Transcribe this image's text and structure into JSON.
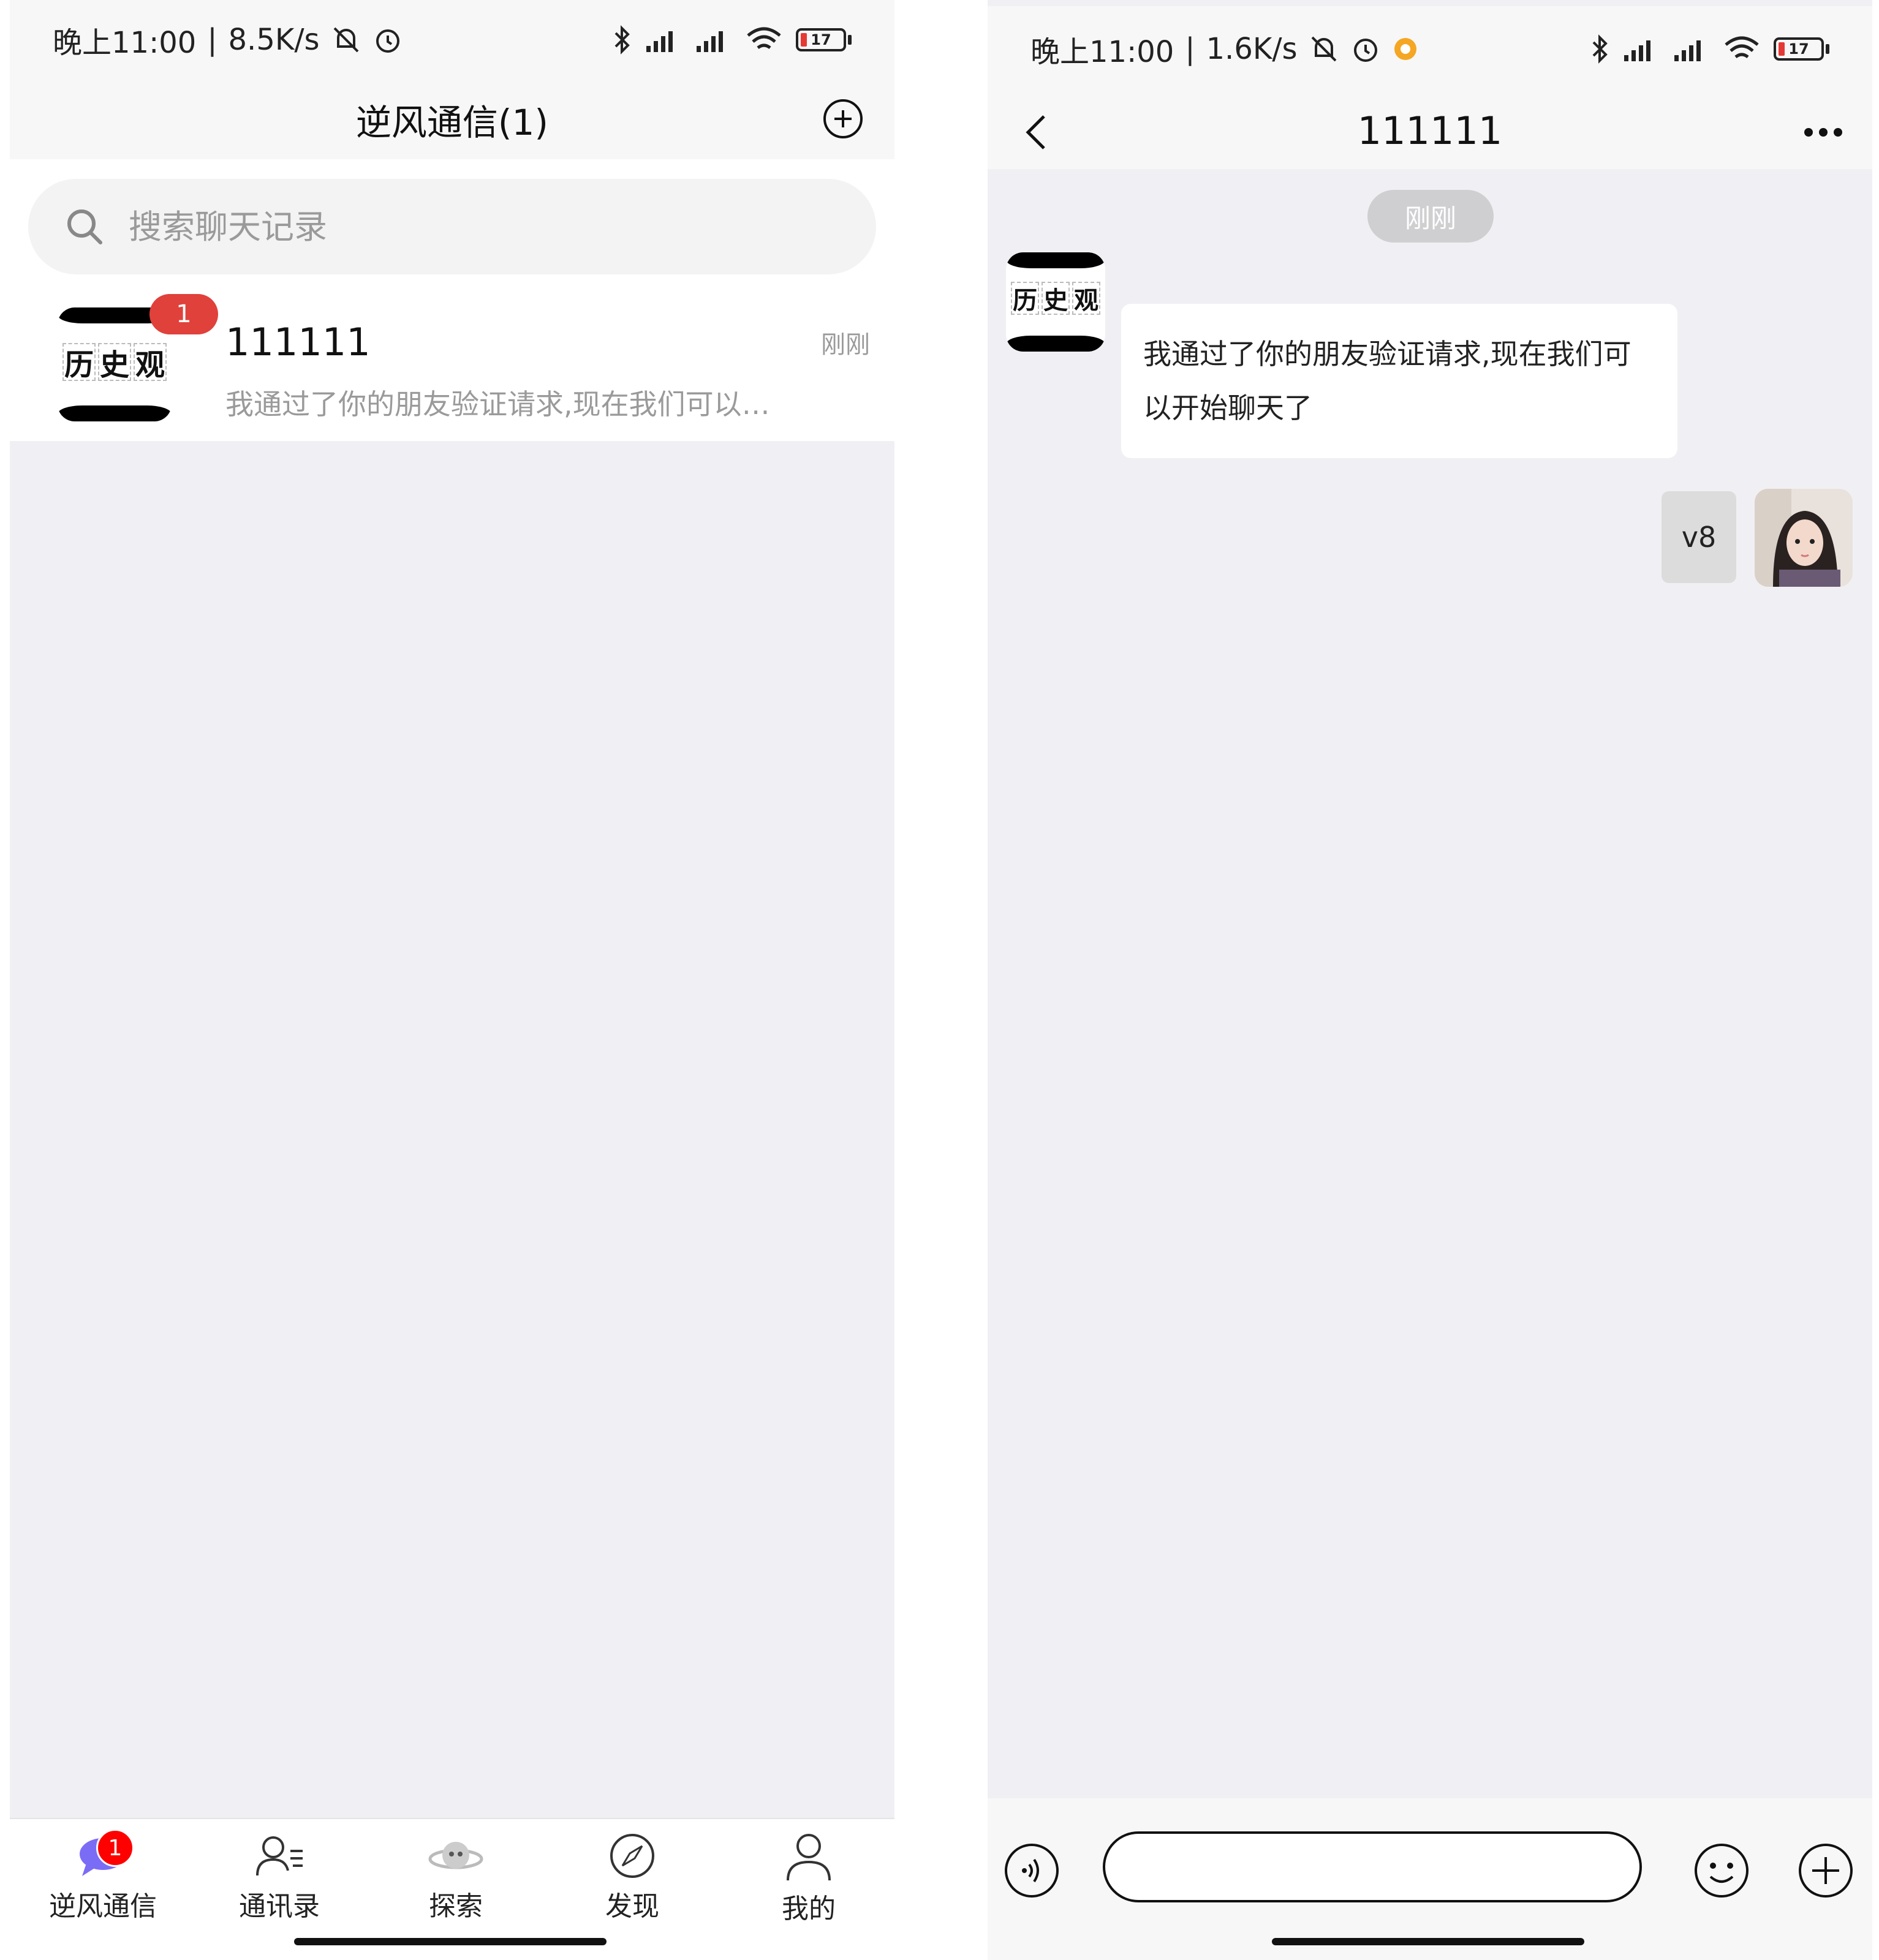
{
  "left_screen": {
    "status_bar": {
      "time": "晚上11:00",
      "separator": "|",
      "net_speed": "8.5K/s",
      "battery": "17"
    },
    "header": {
      "title": "逆风通信(1)",
      "add_icon": "plus-circle-icon"
    },
    "search": {
      "placeholder": "搜索聊天记录",
      "icon": "search-icon"
    },
    "conversations": [
      {
        "name": "111111",
        "time": "刚刚",
        "preview": "我通过了你的朋友验证请求,现在我们可以…",
        "unread": "1",
        "avatar_chars": [
          "历",
          "史",
          "观"
        ]
      }
    ],
    "tabs": [
      {
        "label": "逆风通信",
        "icon": "chat-bubble-icon",
        "badge": "1",
        "active": true
      },
      {
        "label": "通讯录",
        "icon": "contacts-icon"
      },
      {
        "label": "探索",
        "icon": "planet-icon"
      },
      {
        "label": "发现",
        "icon": "compass-icon"
      },
      {
        "label": "我的",
        "icon": "user-icon"
      }
    ]
  },
  "right_screen": {
    "status_bar": {
      "time": "晚上11:00",
      "separator": "|",
      "net_speed": "1.6K/s",
      "battery": "17"
    },
    "header": {
      "title": "111111",
      "back_icon": "chevron-left-icon",
      "more_icon": "more-dots-icon"
    },
    "time_divider": "刚刚",
    "messages": [
      {
        "direction": "incoming",
        "text": "我通过了你的朋友验证请求,现在我们可以开始聊天了",
        "avatar_chars": [
          "历",
          "史",
          "观"
        ]
      },
      {
        "direction": "outgoing",
        "text": "v8"
      }
    ],
    "input_bar": {
      "voice_icon": "voice-icon",
      "text_value": "",
      "emoji_icon": "emoji-icon",
      "plus_icon": "plus-circle-icon"
    }
  },
  "colors": {
    "badge_red": "#e0413b",
    "tab_badge_red": "#ff0000",
    "chat_icon_purple": "#7b6cf6",
    "background": "#f0f0f4"
  }
}
